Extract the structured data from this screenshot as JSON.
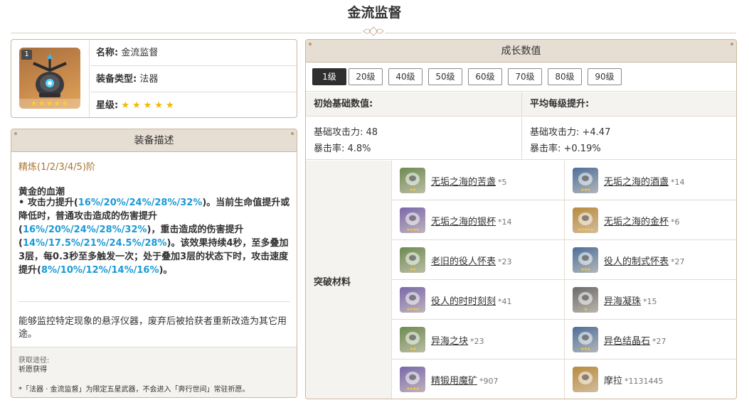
{
  "page": {
    "title": "金流监督"
  },
  "info": {
    "level_badge": "1",
    "weapon_stars": "★★★★★",
    "name_label": "名称:",
    "name_value": "金流监督",
    "type_label": "装备类型:",
    "type_value": "法器",
    "rarity_label": "星级:",
    "rarity_stars": "★★★★★"
  },
  "description": {
    "header": "装备描述",
    "refine": "精炼(1/2/3/4/5)阶",
    "effect_name": "黄金的血潮",
    "effect_parts": [
      {
        "t": " • 攻击力提升(",
        "hl": false
      },
      {
        "t": "16%/20%/24%/28%/32%",
        "hl": true
      },
      {
        "t": ")。当前生命值提升或降低时，普通攻击造成的伤害提升(",
        "hl": false
      },
      {
        "t": "16%/20%/24%/28%/32%",
        "hl": true
      },
      {
        "t": ")，重击造成的伤害提升(",
        "hl": false
      },
      {
        "t": "14%/17.5%/21%/24.5%/28%",
        "hl": true
      },
      {
        "t": ")。该效果持续4秒，至多叠加3层，每0.3秒至多触发一次；处于叠加3层的状态下时，攻击速度提升(",
        "hl": false
      },
      {
        "t": "8%/10%/12%/14%/16%",
        "hl": true
      },
      {
        "t": ")。",
        "hl": false
      }
    ],
    "lore": "能够监控特定现象的悬浮仪器，废弃后被拾获者重新改造为其它用途。",
    "source_label": "获取途径:",
    "source_value": "祈愿获得",
    "note": "*「法器 · 金流监督」为限定五星武器，不会进入「奔行世间」常驻祈愿。"
  },
  "growth": {
    "header": "成长数值",
    "levels": [
      "1级",
      "20级",
      "40级",
      "50级",
      "60级",
      "70级",
      "80级",
      "90级"
    ],
    "active_level": 0,
    "base_header": "初始基础数值:",
    "avg_header": "平均每级提升:",
    "base_stats": [
      "基础攻击力: 48",
      "暴击率: 4.8%"
    ],
    "avg_stats": [
      "基础攻击力: +4.47",
      "暴击率: +0.19%"
    ],
    "materials_label": "突破材料",
    "materials": [
      {
        "name": "无垢之海的苦盏",
        "count": "*5",
        "icon": "bitter-cup-icon",
        "bg": "#6e8a52",
        "stars": "★★"
      },
      {
        "name": "无垢之海的酒盏",
        "count": "*14",
        "icon": "wine-cup-icon",
        "bg": "#4e6f99",
        "stars": "★★★"
      },
      {
        "name": "无垢之海的银杯",
        "count": "*14",
        "icon": "silver-cup-icon",
        "bg": "#7a68a8",
        "stars": "★★★★"
      },
      {
        "name": "无垢之海的金杯",
        "count": "*6",
        "icon": "golden-cup-icon",
        "bg": "#b98a3e",
        "stars": "★★★★★"
      },
      {
        "name": "老旧的役人怀表",
        "count": "*23",
        "icon": "old-watch-icon",
        "bg": "#6e8a52",
        "stars": "★★"
      },
      {
        "name": "役人的制式怀表",
        "count": "*27",
        "icon": "standard-watch-icon",
        "bg": "#4e6f99",
        "stars": "★★★"
      },
      {
        "name": "役人的时时刻刻",
        "count": "*41",
        "icon": "timepiece-icon",
        "bg": "#7a68a8",
        "stars": "★★★★"
      },
      {
        "name": "异海凝珠",
        "count": "*15",
        "icon": "sea-pearl-icon",
        "bg": "#6b6b6b",
        "stars": "★"
      },
      {
        "name": "异海之块",
        "count": "*23",
        "icon": "sea-block-icon",
        "bg": "#6e8a52",
        "stars": "★★"
      },
      {
        "name": "异色结晶石",
        "count": "*27",
        "icon": "crystal-stone-icon",
        "bg": "#4e6f99",
        "stars": "★★★"
      },
      {
        "name": "精锻用魔矿",
        "count": "*907",
        "icon": "mystic-ore-icon",
        "bg": "#7a68a8",
        "stars": "★★★★"
      },
      {
        "name": "摩拉",
        "count": "*1131445",
        "icon": "mora-coin-icon",
        "bg": "#b98a3e",
        "stars": ""
      }
    ]
  }
}
